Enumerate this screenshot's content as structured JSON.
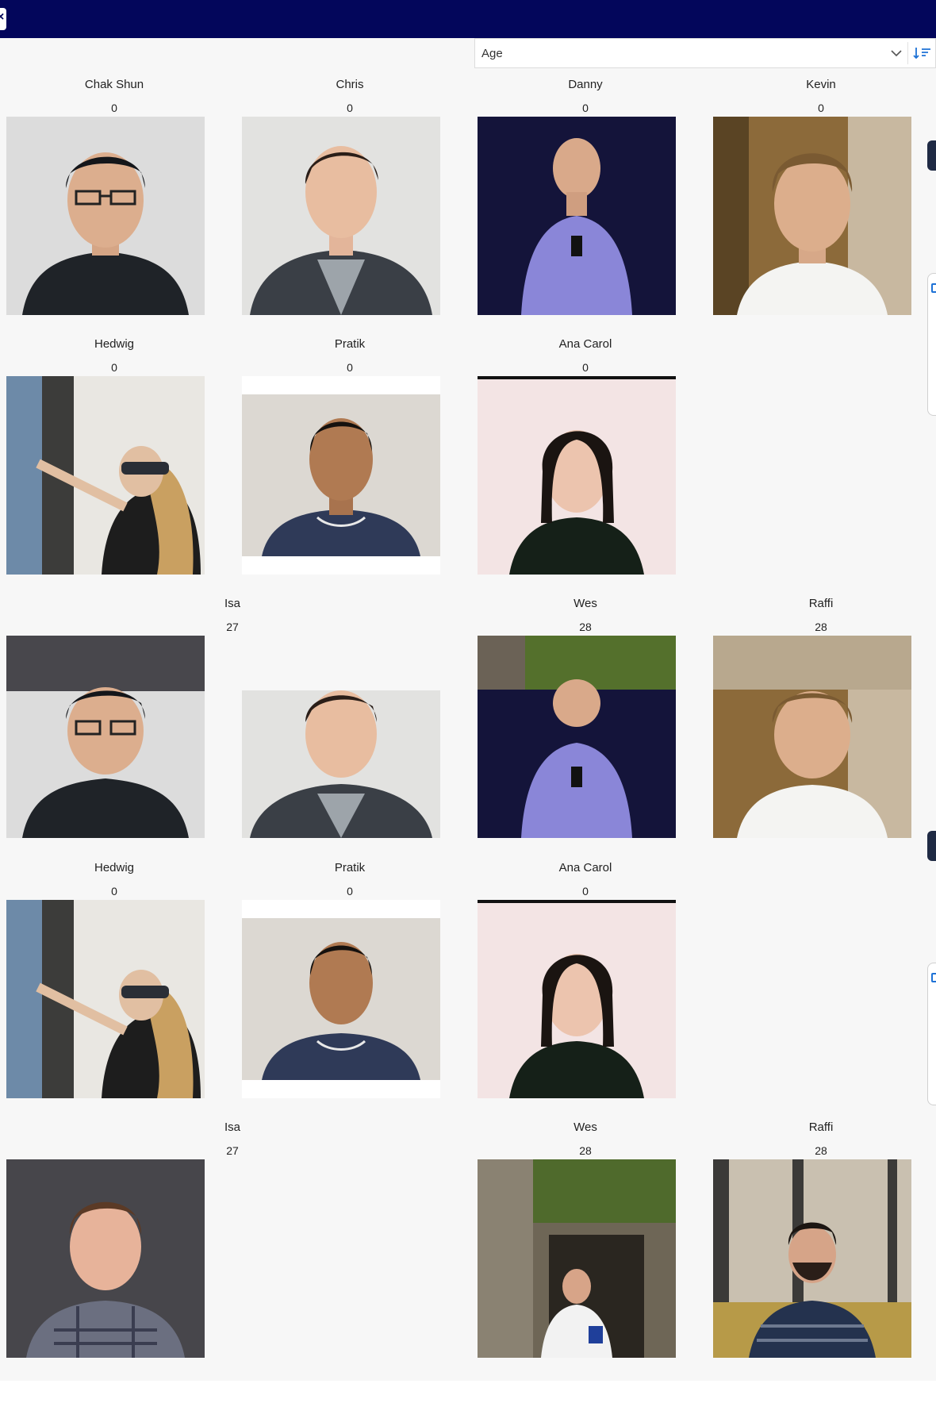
{
  "header": {
    "close_icon": "close-icon"
  },
  "sort": {
    "selected": "Age",
    "chevron_icon": "chevron-down-icon",
    "order_icon": "sort-descending-icon",
    "accent": "#1e72d6"
  },
  "colors": {
    "topbar": "#03065b",
    "background": "#f7f7f7"
  },
  "grid": [
    {
      "name": "Chak Shun",
      "age": "0",
      "photo": "photo-chak-shun"
    },
    {
      "name": "Chris",
      "age": "0",
      "photo": "photo-chris"
    },
    {
      "name": "Danny",
      "age": "0",
      "photo": "photo-danny"
    },
    {
      "name": "Kevin",
      "age": "0",
      "photo": "photo-kevin"
    },
    {
      "name": "Hedwig",
      "age": "0",
      "photo": "photo-hedwig"
    },
    {
      "name": "Pratik",
      "age": "0",
      "photo": "photo-pratik"
    },
    {
      "name": "Ana Carol",
      "age": "0",
      "photo": "photo-ana-carol"
    },
    {
      "name": "Isa",
      "age": "27",
      "photo": "photo-chak-shun"
    },
    {
      "name": "",
      "age": "",
      "photo": "photo-chris"
    },
    {
      "name": "Wes",
      "age": "28",
      "photo": "photo-danny"
    },
    {
      "name": "Raffi",
      "age": "28",
      "photo": "photo-kevin"
    },
    {
      "name": "Hedwig",
      "age": "0",
      "photo": "photo-hedwig"
    },
    {
      "name": "Pratik",
      "age": "0",
      "photo": "photo-pratik"
    },
    {
      "name": "Ana Carol",
      "age": "0",
      "photo": "photo-ana-carol"
    },
    {
      "name": "Isa",
      "age": "27",
      "photo": "photo-isa"
    },
    {
      "name": "",
      "age": "",
      "photo": ""
    },
    {
      "name": "Wes",
      "age": "28",
      "photo": "photo-wes"
    },
    {
      "name": "Raffi",
      "age": "28",
      "photo": "photo-raffi"
    }
  ]
}
